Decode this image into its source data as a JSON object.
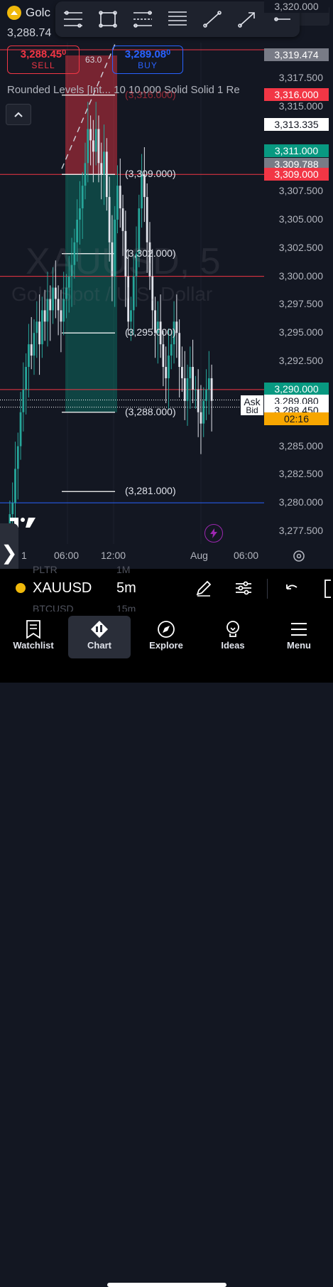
{
  "header": {
    "symbol_short": "Golc",
    "last_price": "3,288.74",
    "sell_price": "3,288.45",
    "sell_price_small": "0",
    "sell_label": "SELL",
    "spread": "63.0",
    "buy_price": "3,289.08",
    "buy_price_small": "0",
    "buy_label": "BUY"
  },
  "toolbar": {
    "tools": [
      "fib-levels-icon",
      "rectangle-icon",
      "fib-channel-icon",
      "horizontal-lines-icon",
      "trend-line-icon",
      "arrow-line-icon",
      "horizontal-ray-icon"
    ]
  },
  "indicator": {
    "text": "Rounded Levels [Int...  10 10,000 Solid Solid 1 Re"
  },
  "watermark": {
    "symbol": "XAUUSD, 5",
    "description": "Gold Spot / U.S. Dollar"
  },
  "price_axis": {
    "labels": [
      {
        "text": "3,317.500",
        "price": 3317.5
      },
      {
        "text": "3,315.000",
        "price": 3315
      },
      {
        "text": "3,307.500",
        "price": 3307.5
      },
      {
        "text": "3,305.000",
        "price": 3305
      },
      {
        "text": "3,302.500",
        "price": 3302.5
      },
      {
        "text": "3,300.000",
        "price": 3300
      },
      {
        "text": "3,297.500",
        "price": 3297.5
      },
      {
        "text": "3,295.000",
        "price": 3295
      },
      {
        "text": "3,292.500",
        "price": 3292.5
      },
      {
        "text": "3,285.000",
        "price": 3285
      },
      {
        "text": "3,282.500",
        "price": 3282.5
      },
      {
        "text": "3,280.000",
        "price": 3280
      },
      {
        "text": "3,277.500",
        "price": 3277.5
      }
    ],
    "tags": [
      {
        "text": "3,320.000",
        "price": 3320,
        "bg": "#131722",
        "color": "#b2b5be"
      },
      {
        "text": "3,319.474",
        "price": 3319.474,
        "bg": "#787b86",
        "color": "#ffffff"
      },
      {
        "text": "3,316.000",
        "price": 3316,
        "bg": "#f23645",
        "color": "#ffffff"
      },
      {
        "text": "3,313.335",
        "price": 3313.335,
        "bg": "#ffffff",
        "color": "#131722"
      },
      {
        "text": "3,311.000",
        "price": 3311,
        "bg": "#089981",
        "color": "#ffffff"
      },
      {
        "text": "3,309.788",
        "price": 3309.788,
        "bg": "#787b86",
        "color": "#ffffff"
      },
      {
        "text": "3,309.000",
        "price": 3309,
        "bg": "#f23645",
        "color": "#ffffff"
      },
      {
        "text": "3,290.000",
        "price": 3290,
        "bg": "#089981",
        "color": "#ffffff"
      },
      {
        "text": "3,289.080",
        "price": 3289.08,
        "bg": "#ffffff",
        "color": "#131722"
      },
      {
        "text": "3,288.450",
        "price": 3288.45,
        "bg": "#ffffff",
        "color": "#131722"
      },
      {
        "text": "02:16",
        "price": 3287.5,
        "bg": "#f7a600",
        "color": "#131722"
      }
    ],
    "ask_label": "Ask",
    "bid_label": "Bid"
  },
  "levels": [
    {
      "text": "(3,316.000)",
      "price": 3316
    },
    {
      "text": "(3,309.000)",
      "price": 3309
    },
    {
      "text": "(3,302.000)",
      "price": 3302
    },
    {
      "text": "(3,295.000)",
      "price": 3295
    },
    {
      "text": "(3,288.000)",
      "price": 3288
    },
    {
      "text": "(3,281.000)",
      "price": 3281
    }
  ],
  "horizontal_lines": [
    {
      "price": 3320,
      "color": "#f23645"
    },
    {
      "price": 3309,
      "color": "#f23645"
    },
    {
      "price": 3300,
      "color": "#f23645"
    },
    {
      "price": 3290,
      "color": "#f23645"
    },
    {
      "price": 3280,
      "color": "#2962ff"
    }
  ],
  "time_axis": {
    "labels": [
      {
        "text": "1",
        "index": 0
      },
      {
        "text": "06:00",
        "index": 72
      },
      {
        "text": "12:00",
        "index": 144
      },
      {
        "text": "Aug",
        "index": 252
      },
      {
        "text": "06:00",
        "index": 324
      }
    ]
  },
  "chart_data": {
    "type": "candlestick",
    "y_range": [
      3276,
      3322
    ],
    "risk_zone": {
      "from_price": 3309,
      "to_price": 3316
    },
    "reward_zone": {
      "from_price": 3288,
      "to_price": 3309
    },
    "close_series": [
      3279,
      3280,
      3283,
      3285,
      3288,
      3290,
      3292,
      3294,
      3293,
      3295,
      3296,
      3294,
      3297,
      3296,
      3298,
      3297,
      3299,
      3298,
      3297,
      3296,
      3298,
      3299,
      3300,
      3301,
      3303,
      3305,
      3306,
      3308,
      3310,
      3313,
      3312,
      3311,
      3313,
      3310,
      3309,
      3311,
      3307,
      3303,
      3300,
      3305,
      3308,
      3306,
      3304,
      3300,
      3296,
      3297,
      3300,
      3302,
      3306,
      3309,
      3307,
      3303,
      3300,
      3297,
      3295,
      3296,
      3294,
      3292,
      3291,
      3293,
      3294,
      3296,
      3295,
      3292,
      3291,
      3289,
      3291,
      3292,
      3290,
      3290,
      3288,
      3287,
      3289,
      3290,
      3291,
      3289
    ]
  },
  "bottom": {
    "symbol": "XAUUSD",
    "interval": "5m",
    "ghost_symbol_1": "PLTR",
    "ghost_interval_1": "1M",
    "ghost_symbol_2": "BTCUSD",
    "ghost_interval_2": "15m"
  },
  "nav": [
    {
      "label": "Watchlist",
      "icon": "watchlist-icon",
      "active": false
    },
    {
      "label": "Chart",
      "icon": "chart-icon",
      "active": true
    },
    {
      "label": "Explore",
      "icon": "compass-icon",
      "active": false
    },
    {
      "label": "Ideas",
      "icon": "lightbulb-icon",
      "active": false
    },
    {
      "label": "Menu",
      "icon": "menu-icon",
      "active": false
    }
  ]
}
